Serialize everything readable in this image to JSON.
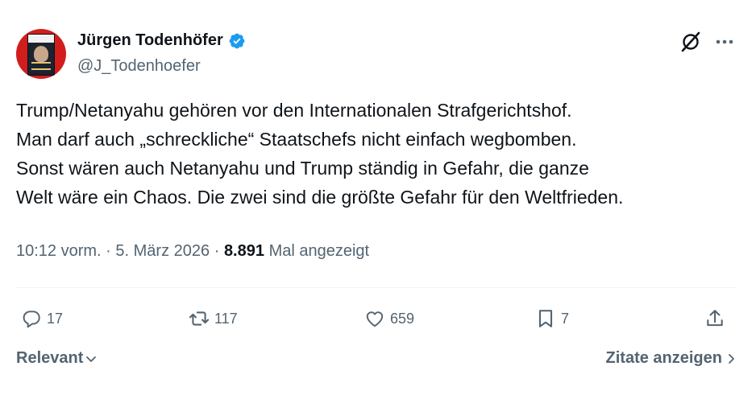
{
  "author": {
    "name": "Jürgen Todenhöfer",
    "handle": "@J_Todenhoefer"
  },
  "tweet": {
    "text": "Trump/Netanyahu gehören vor den Internationalen Strafgerichtshof.\nMan darf auch „schreckliche“ Staatschefs nicht einfach wegbomben.\nSonst wären auch Netanyahu und Trump ständig in Gefahr, die ganze\nWelt wäre ein Chaos. Die zwei sind die größte Gefahr für den Weltfrieden."
  },
  "meta": {
    "time": "10:12 vorm.",
    "separator": "·",
    "date": "5. März 2026",
    "views_count": "8.891",
    "views_label": "Mal angezeigt"
  },
  "actions": {
    "replies": "17",
    "retweets": "117",
    "likes": "659",
    "bookmarks": "7"
  },
  "footer": {
    "sort_label": "Relevant",
    "quotes_label": "Zitate anzeigen"
  },
  "colors": {
    "verified": "#1d9bf0",
    "secondary_text": "#536471",
    "avatar_bg": "#d21d1d"
  },
  "icons": [
    "verified-badge-icon",
    "grok-icon",
    "more-icon",
    "reply-icon",
    "retweet-icon",
    "like-icon",
    "bookmark-icon",
    "share-icon",
    "chevron-down-icon",
    "chevron-right-icon"
  ]
}
